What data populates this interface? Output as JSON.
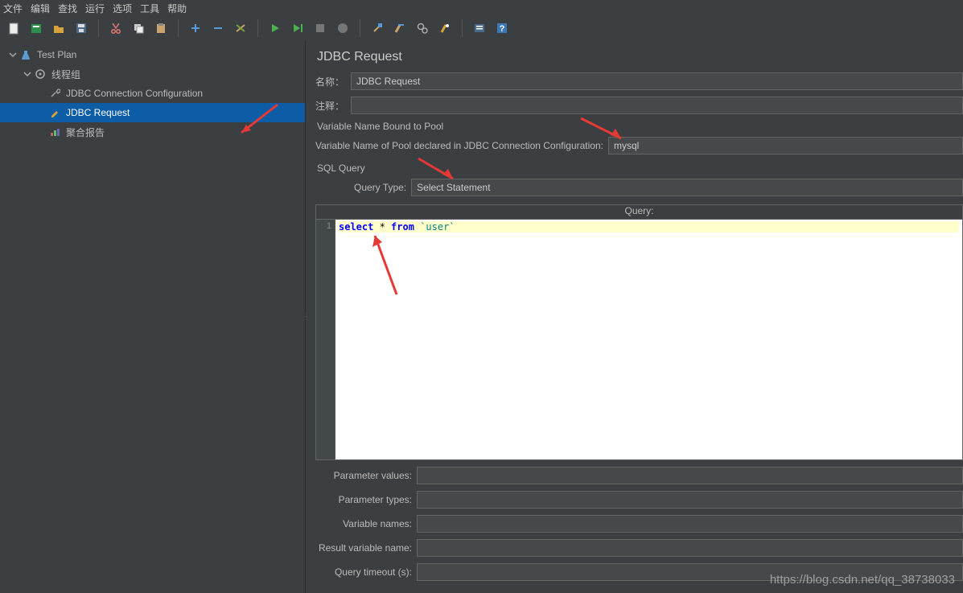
{
  "menu": {
    "items": [
      "文件",
      "编辑",
      "查找",
      "运行",
      "选项",
      "工具",
      "帮助"
    ]
  },
  "tree": {
    "root": "Test Plan",
    "thread_group": "线程组",
    "jdbc_conn": "JDBC Connection Configuration",
    "jdbc_req": "JDBC Request",
    "agg_report": "聚合报告"
  },
  "panel": {
    "title": "JDBC Request",
    "name_label": "名称：",
    "name_value": "JDBC Request",
    "comment_label": "注释：",
    "comment_value": "",
    "pool_group": "Variable Name Bound to Pool",
    "pool_label": "Variable Name of Pool declared in JDBC Connection Configuration:",
    "pool_value": "mysql",
    "sql_group": "SQL Query",
    "query_type_label": "Query Type:",
    "query_type_value": "Select Statement",
    "query_header": "Query:",
    "gutter_line": "1",
    "sql_kw_select": "select",
    "sql_star": " * ",
    "sql_kw_from": "from",
    "sql_table": " `user`",
    "param_values_label": "Parameter values:",
    "param_values": "",
    "param_types_label": "Parameter types:",
    "param_types": "",
    "var_names_label": "Variable names:",
    "var_names": "",
    "result_var_label": "Result variable name:",
    "result_var": "",
    "query_timeout_label": "Query timeout (s):",
    "query_timeout": ""
  },
  "watermark": "https://blog.csdn.net/qq_38738033"
}
